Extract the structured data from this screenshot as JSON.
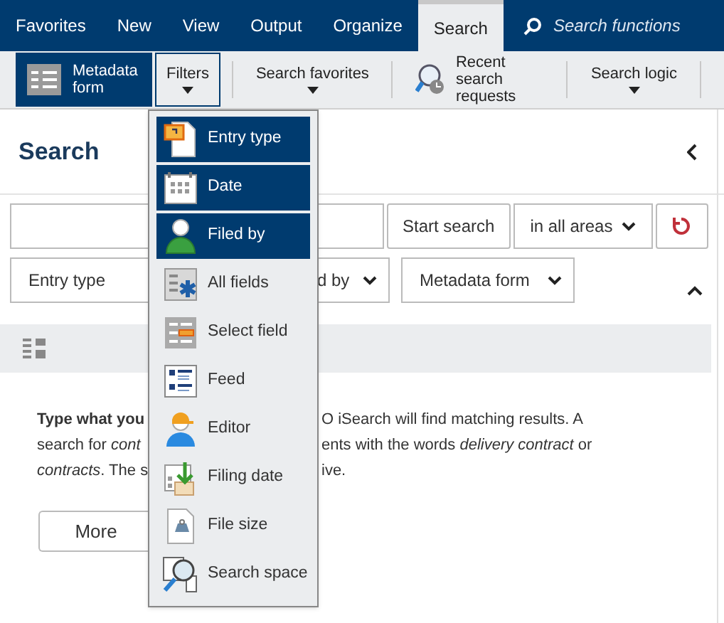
{
  "nav_tabs": [
    {
      "label": "Favorites",
      "selected": false
    },
    {
      "label": "New",
      "selected": false
    },
    {
      "label": "View",
      "selected": false
    },
    {
      "label": "Output",
      "selected": false
    },
    {
      "label": "Organize",
      "selected": false
    },
    {
      "label": "Search",
      "selected": true
    }
  ],
  "search_functions": {
    "placeholder": "Search functions"
  },
  "ribbon": [
    {
      "label": "Metadata form",
      "kind": "button",
      "selected": true,
      "expanded": false
    },
    {
      "label": "Filters",
      "kind": "dropdown",
      "selected": false,
      "expanded": true
    },
    {
      "label": "Search favorites",
      "kind": "dropdown",
      "selected": false,
      "expanded": false
    },
    {
      "label": "Recent search requests",
      "kind": "button",
      "selected": false,
      "expanded": false
    },
    {
      "label": "Search logic",
      "kind": "dropdown",
      "selected": false,
      "expanded": false
    }
  ],
  "panel": {
    "title": "Search",
    "start_button": "Start search",
    "area_select": "in all areas",
    "filters": [
      {
        "label": "Entry type"
      },
      {
        "label": "d by"
      },
      {
        "label": "Metadata form"
      }
    ],
    "text_lines": [
      {
        "left": "**Type what you**",
        "right": "O iSearch will find matching results. A"
      },
      {
        "left": "search for *cont*",
        "right": "ents with the words *delivery contract* or"
      },
      {
        "left": "*contracts*. The s",
        "right": "ive."
      }
    ],
    "more_button": "More"
  },
  "filter_menu": [
    {
      "label": "Entry type",
      "selected": true
    },
    {
      "label": "Date",
      "selected": true
    },
    {
      "label": "Filed by",
      "selected": true
    },
    {
      "label": "All fields",
      "selected": false
    },
    {
      "label": "Select field",
      "selected": false
    },
    {
      "label": "Feed",
      "selected": false
    },
    {
      "label": "Editor",
      "selected": false
    },
    {
      "label": "Filing date",
      "selected": false
    },
    {
      "label": "File size",
      "selected": false
    },
    {
      "label": "Search space",
      "selected": false
    }
  ]
}
